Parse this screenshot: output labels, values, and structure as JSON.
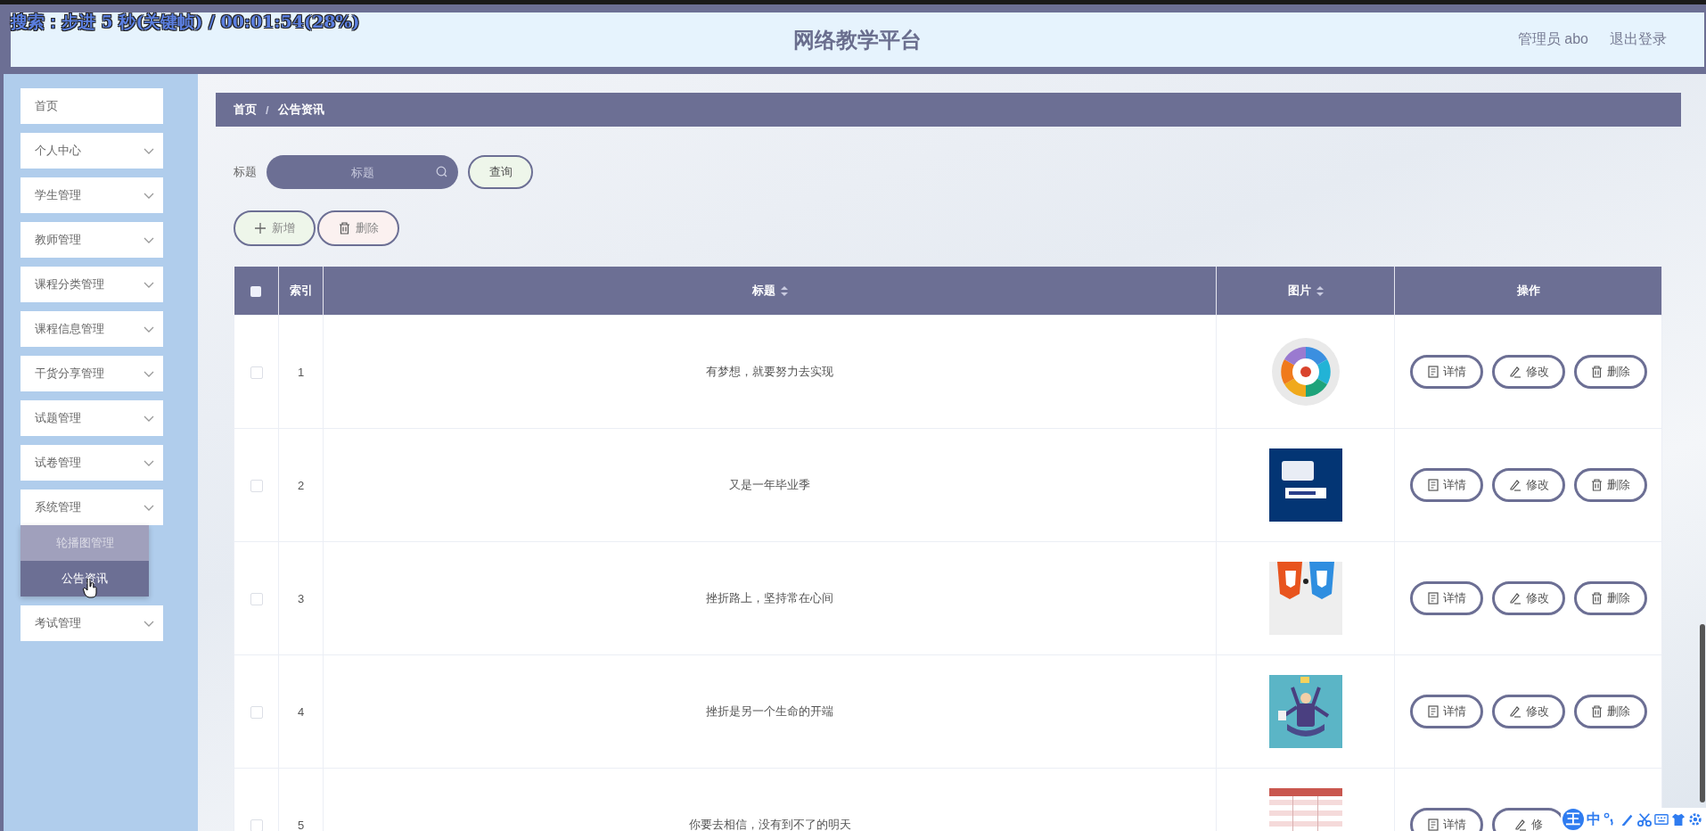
{
  "player_osd": {
    "text": "搜索：步进 5 秒(关键帧) / 00:01:54(28%)"
  },
  "header": {
    "title": "网络教学平台",
    "user": "管理员 abo",
    "logout": "退出登录"
  },
  "sidebar": {
    "items": [
      {
        "kind": "link",
        "label": "首页"
      },
      {
        "kind": "submenu",
        "label": "个人中心"
      },
      {
        "kind": "submenu",
        "label": "学生管理"
      },
      {
        "kind": "submenu",
        "label": "教师管理"
      },
      {
        "kind": "submenu",
        "label": "课程分类管理"
      },
      {
        "kind": "submenu",
        "label": "课程信息管理"
      },
      {
        "kind": "submenu",
        "label": "干货分享管理"
      },
      {
        "kind": "submenu",
        "label": "试题管理"
      },
      {
        "kind": "submenu",
        "label": "试卷管理"
      },
      {
        "kind": "submenu",
        "label": "系统管理",
        "children": [
          {
            "label": "轮播图管理",
            "selected": false
          },
          {
            "label": "公告资讯",
            "selected": true
          }
        ]
      },
      {
        "kind": "submenu",
        "label": "考试管理"
      }
    ]
  },
  "breadcrumb": {
    "items": [
      "首页",
      "公告资讯"
    ],
    "separator": "/"
  },
  "search": {
    "label": "标题",
    "placeholder": "标题",
    "button": "查询"
  },
  "toolbar": [
    {
      "kind": "add",
      "label": "新增"
    },
    {
      "kind": "delete",
      "label": "删除"
    }
  ],
  "table": {
    "header_checkbox": {
      "checked": false
    },
    "columns": [
      {
        "label": "索引",
        "sortable": false
      },
      {
        "label": "标题",
        "sortable": true
      },
      {
        "label": "图片",
        "sortable": true
      },
      {
        "label": "操作",
        "sortable": false
      }
    ],
    "rows": [
      {
        "checked": false,
        "index": "1",
        "title": "有梦想，就要努力去实现",
        "picture": {
          "kind": "picture"
        },
        "actions": [
          {
            "kind": "detail",
            "label": "详情"
          },
          {
            "kind": "edit",
            "label": "修改"
          },
          {
            "kind": "delete",
            "label": "删除"
          }
        ]
      },
      {
        "checked": false,
        "index": "2",
        "title": "又是一年毕业季",
        "picture": {
          "kind": "picture"
        },
        "actions": [
          {
            "kind": "detail",
            "label": "详情"
          },
          {
            "kind": "edit",
            "label": "修改"
          },
          {
            "kind": "delete",
            "label": "删除"
          }
        ]
      },
      {
        "checked": false,
        "index": "3",
        "title": "挫折路上，坚持常在心间",
        "picture": {
          "kind": "picture"
        },
        "actions": [
          {
            "kind": "detail",
            "label": "详情"
          },
          {
            "kind": "edit",
            "label": "修改"
          },
          {
            "kind": "delete",
            "label": "删除"
          }
        ]
      },
      {
        "checked": false,
        "index": "4",
        "title": "挫折是另一个生命的开端",
        "picture": {
          "kind": "picture"
        },
        "actions": [
          {
            "kind": "detail",
            "label": "详情"
          },
          {
            "kind": "edit",
            "label": "修改"
          },
          {
            "kind": "delete",
            "label": "删除"
          }
        ]
      },
      {
        "checked": false,
        "index": "5",
        "title": "你要去相信，没有到不了的明天",
        "picture": {
          "kind": "picture"
        },
        "actions": [
          {
            "kind": "detail",
            "label": "详情"
          },
          {
            "kind": "edit",
            "label": "修"
          }
        ]
      }
    ]
  },
  "ime_bar": {
    "logo": "王",
    "mode": "中"
  }
}
